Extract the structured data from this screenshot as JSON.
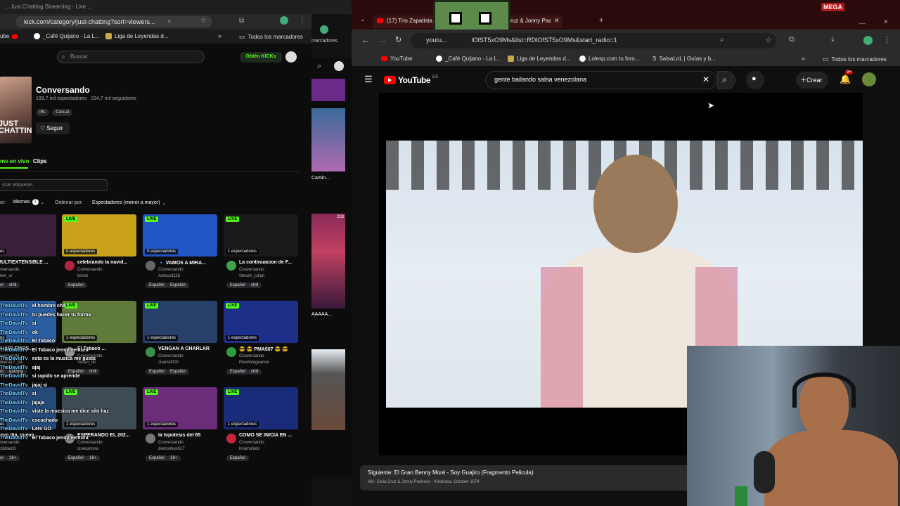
{
  "left_browser": {
    "tab_title": "... Just Chatting Streaming - Live ...",
    "url": "kick.com/category/just-chatting?sort=viewers...",
    "bookmarks": [
      "ube",
      "_Café Quijano - La L...",
      "Liga de Leyendas d...",
      "Todos los marcadores"
    ]
  },
  "kick": {
    "search_placeholder": "Buscar",
    "cta_label": "Obtén KICKs",
    "category_title": "Conversando",
    "category_thumb_text": "JUST\nCHATTING",
    "stats": "199,7 mil espectadores   234,7 mil seguidores",
    "tags": [
      "IRL",
      "Casual"
    ],
    "follow_label": "Seguir",
    "tabs": [
      "ms en vivo",
      "Clips"
    ],
    "filter_placeholder": "scar etiquetas",
    "filter_prefix": "or:",
    "languages_label": "Idiomas",
    "languages_count": "1",
    "order_label": "Ordenar por:",
    "order_value": "Espectadores (menor a mayor)",
    "cards": [
      {
        "title": "MULTIEXTENSIBLE ...",
        "viewers": "ectadores",
        "category": "onversando",
        "user": "olem_vr",
        "chips": [
          "Español",
          "chill"
        ],
        "thumb_color": "#3a1f3a",
        "avatar": "#888"
      },
      {
        "title": "celebrando la navid...",
        "viewers": "0 espectadores",
        "category": "Conversando",
        "user": "terrez",
        "chips": [
          "Español"
        ],
        "thumb_color": "#c9a21a",
        "avatar": "#b1253b"
      },
      {
        "title": "🔹 VAMOS A MIRA...",
        "viewers": "0 espectadores",
        "category": "Conversando",
        "user": "Arzeus1116",
        "chips": [
          "Español",
          "Español"
        ],
        "thumb_color": "#2256c4",
        "avatar": "#666"
      },
      {
        "title": "La continuacion de F...",
        "viewers": "1 espectadores",
        "category": "Conversando",
        "user": "Steven_julian",
        "chips": [
          "Español",
          "chill"
        ],
        "thumb_color": "#1a1a1a",
        "avatar": "#3fa34d"
      },
      {
        "title": "CHARLEMOS...",
        "viewers": "ectadores",
        "category": "onversando",
        "user": "ekken117_24",
        "chips": [
          "Español",
          "gaming"
        ],
        "thumb_color": "#2b5ea0",
        "avatar": "#777"
      },
      {
        "title": "El Tabaco ...",
        "viewers": "1 espectadores",
        "category": "Conversando",
        "user": "Yosan_dll",
        "chips": [
          "Español",
          "chill"
        ],
        "thumb_color": "#5f7a3a",
        "avatar": "#999"
      },
      {
        "title": "VENGAN A CHARLAR",
        "viewers": "1 espectadores",
        "category": "Conversando",
        "user": "Juansit000",
        "chips": [
          "Español",
          "Español"
        ],
        "thumb_color": "#28406a",
        "avatar": "#3b8f4a"
      },
      {
        "title": "😎 😎 PMA507 😎 😎",
        "viewers": "1 espectadores",
        "category": "Conversando",
        "user": "PureVengeance",
        "chips": [
          "Español",
          "chill"
        ],
        "thumb_color": "#1e2f8a",
        "avatar": "#2f9a3e"
      },
      {
        "title": "uevo dia, nueva...",
        "viewers": "ectadores",
        "category": "onversando",
        "user": "0n3dlant3",
        "chips": [
          "Español",
          "18+"
        ],
        "thumb_color": "#244a7a",
        "avatar": "#777"
      },
      {
        "title": "ESPERANDO EL 202...",
        "viewers": "1 espectadores",
        "category": "Conversando",
        "user": "cinecarrera",
        "chips": [
          "Español",
          "18+"
        ],
        "thumb_color": "#3e4b52",
        "avatar": "#888"
      },
      {
        "title": "la hipotesis del 65",
        "viewers": "1 espectadores",
        "category": "Conversando",
        "user": "demonkush17",
        "chips": [
          "Español",
          "18+"
        ],
        "thumb_color": "#6b2c7a",
        "avatar": "#777"
      },
      {
        "title": "COMO SE INICIA EN ...",
        "viewers": "1 espectadores",
        "category": "Conversando",
        "user": "hiramshido",
        "chips": [
          "Español"
        ],
        "thumb_color": "#1a2b7a",
        "avatar": "#c9263d"
      }
    ],
    "chat_overlay": [
      "el hombre cha",
      "tu puedes hacer tu forma",
      "si",
      "ok",
      "El Tabaco",
      "El Tabaco jenny ventura",
      "esta es la musica me gusta",
      "ajaj",
      "si rapido se aprende",
      "jajaj si",
      "si",
      "jajaja",
      "viste la mucsica me dice silo haz",
      "escuchado",
      "Lets GO",
      "El Tabaco jenny ventura"
    ],
    "chat_user": "TheDavidTv"
  },
  "mid_column": {
    "card_title": "Camin...",
    "card_text": "AAAAA...",
    "badge": "228"
  },
  "right_browser": {
    "tab_title": "(17) Trio Zapatista",
    "tab_title_2": "lia Cruz & Jonny Pac",
    "url": "youtu...              lOfST5xO9Ms&list=RDlOfST5xO9Ms&start_radio=1",
    "bookmarks": [
      "YouTube",
      "_Café Quijano - La L...",
      "Liga de Leyendas d...",
      "Lolesp.com tu foro...",
      "SalsaLoL | Guías y b...",
      "Todos los marcadores"
    ],
    "top_right_label": "MEGA"
  },
  "youtube": {
    "logo_text": "YouTube",
    "region": "ES",
    "search_query": "gente bailando salsa venezolana",
    "create_label": "Crear",
    "notif_count": "9+",
    "next_label": "Siguiente: El Gran Benny Moré - Soy Guajiro (Fragmento Pelicula)",
    "mix_label": "Mix: Celia Cruz & Jonny Pacheco - Kinshasa, October 1974"
  },
  "icons": {
    "search": "search-icon",
    "mic": "mic-icon",
    "bell": "bell-icon",
    "clear": "close-icon",
    "menu": "menu-icon",
    "heart": "heart-icon"
  },
  "colors": {
    "kick_green": "#53fc18",
    "youtube_red": "#ff0000",
    "bg": "#0f0f0f"
  }
}
